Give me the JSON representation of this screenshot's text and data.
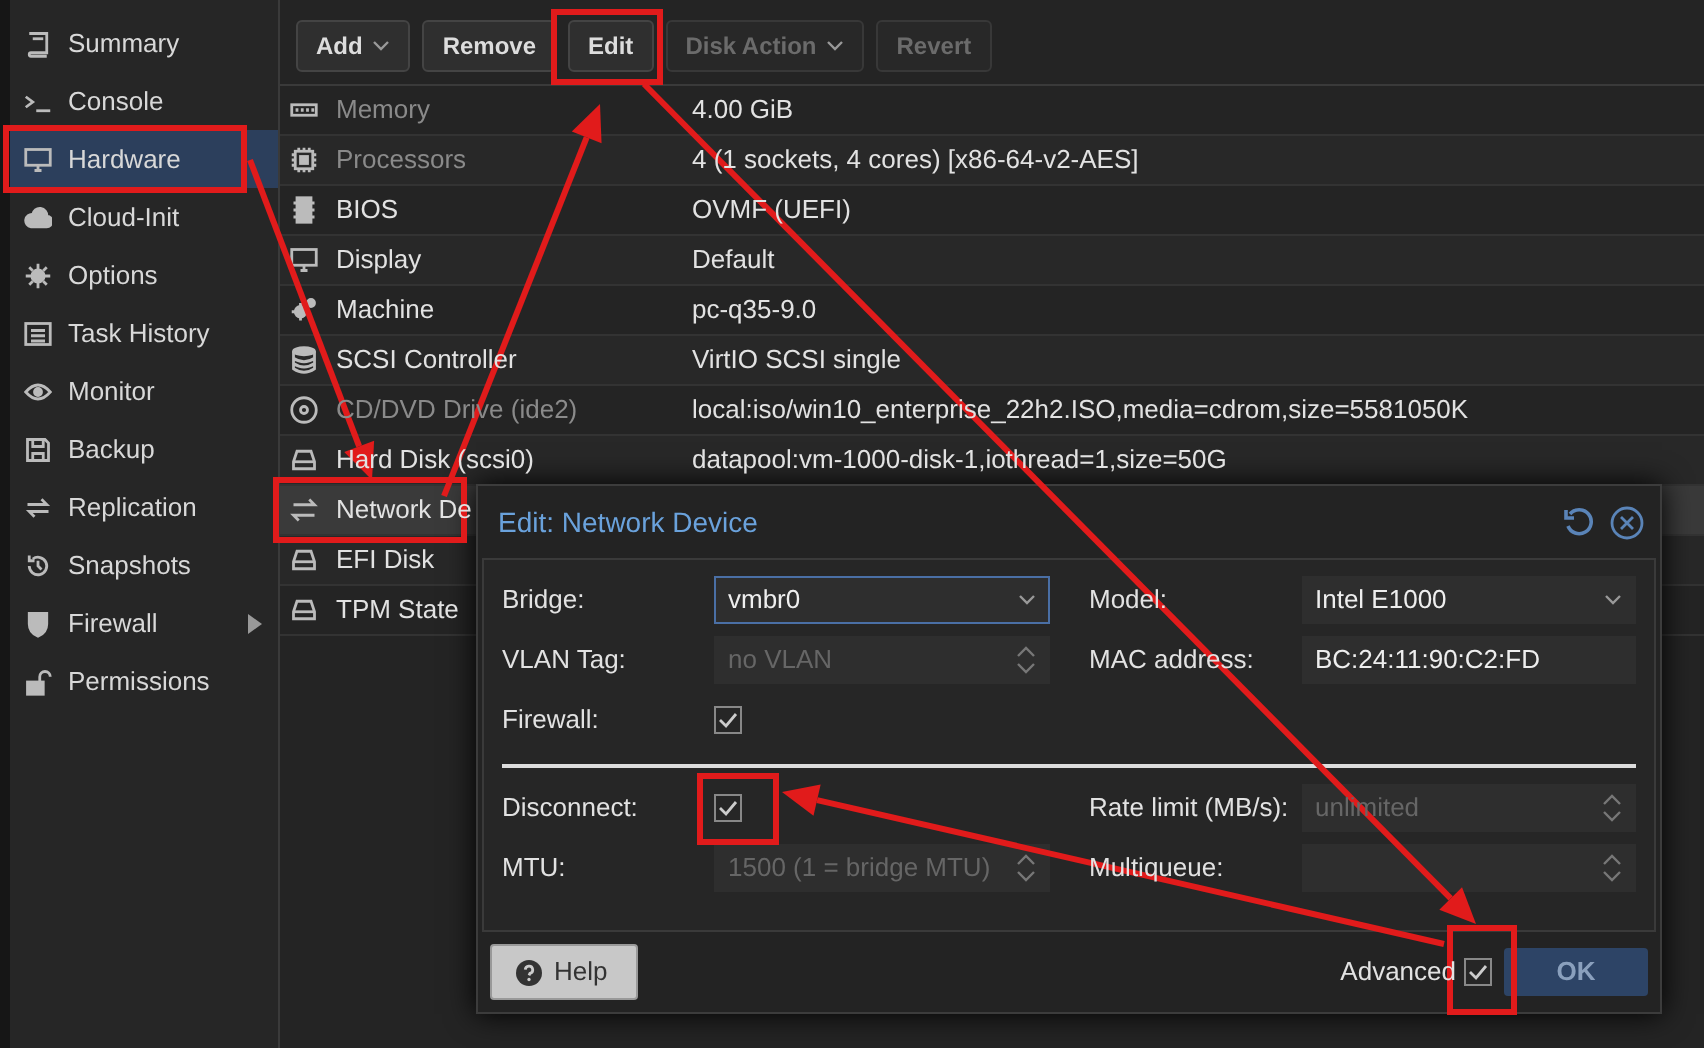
{
  "sidebar": {
    "items": [
      {
        "label": "Summary",
        "selected": false,
        "expandable": false
      },
      {
        "label": "Console",
        "selected": false,
        "expandable": false
      },
      {
        "label": "Hardware",
        "selected": true,
        "expandable": false
      },
      {
        "label": "Cloud-Init",
        "selected": false,
        "expandable": false
      },
      {
        "label": "Options",
        "selected": false,
        "expandable": false
      },
      {
        "label": "Task History",
        "selected": false,
        "expandable": false
      },
      {
        "label": "Monitor",
        "selected": false,
        "expandable": false
      },
      {
        "label": "Backup",
        "selected": false,
        "expandable": false
      },
      {
        "label": "Replication",
        "selected": false,
        "expandable": false
      },
      {
        "label": "Snapshots",
        "selected": false,
        "expandable": false
      },
      {
        "label": "Firewall",
        "selected": false,
        "expandable": true
      },
      {
        "label": "Permissions",
        "selected": false,
        "expandable": false
      }
    ]
  },
  "toolbar": {
    "buttons": [
      {
        "label": "Add",
        "dropdown": true,
        "disabled": false
      },
      {
        "label": "Remove",
        "dropdown": false,
        "disabled": false
      },
      {
        "label": "Edit",
        "dropdown": false,
        "disabled": false
      },
      {
        "label": "Disk Action",
        "dropdown": true,
        "disabled": true
      },
      {
        "label": "Revert",
        "dropdown": false,
        "disabled": true
      }
    ]
  },
  "hardware": {
    "rows": [
      {
        "name": "Memory",
        "value": "4.00 GiB",
        "dimmed": true,
        "selected": false
      },
      {
        "name": "Processors",
        "value": "4 (1 sockets, 4 cores) [x86-64-v2-AES]",
        "dimmed": true,
        "selected": false
      },
      {
        "name": "BIOS",
        "value": "OVMF (UEFI)",
        "dimmed": false,
        "selected": false
      },
      {
        "name": "Display",
        "value": "Default",
        "dimmed": false,
        "selected": false
      },
      {
        "name": "Machine",
        "value": "pc-q35-9.0",
        "dimmed": false,
        "selected": false
      },
      {
        "name": "SCSI Controller",
        "value": "VirtIO SCSI single",
        "dimmed": false,
        "selected": false
      },
      {
        "name": "CD/DVD Drive (ide2)",
        "value": "local:iso/win10_enterprise_22h2.ISO,media=cdrom,size=5581050K",
        "dimmed": true,
        "selected": false
      },
      {
        "name": "Hard Disk (scsi0)",
        "value": "datapool:vm-1000-disk-1,iothread=1,size=50G",
        "dimmed": false,
        "selected": false
      },
      {
        "name": "Network De",
        "dimmed": false,
        "selected": true
      },
      {
        "name": "EFI Disk",
        "dimmed": false,
        "selected": false
      },
      {
        "name": "TPM State",
        "dimmed": false,
        "selected": false
      }
    ]
  },
  "dialog": {
    "title": "Edit: Network Device",
    "general": {
      "left": [
        {
          "label": "Bridge:",
          "kind": "select",
          "value": "vmbr0",
          "focused": true
        },
        {
          "label": "VLAN Tag:",
          "kind": "spinner",
          "placeholder": "no VLAN",
          "focused": false
        },
        {
          "label": "Firewall:",
          "kind": "checkbox",
          "checked": true
        }
      ],
      "right": [
        {
          "label": "Model:",
          "kind": "select",
          "value": "Intel E1000",
          "focused": false
        },
        {
          "label": "MAC address:",
          "kind": "text",
          "value": "BC:24:11:90:C2:FD",
          "focused": false
        }
      ]
    },
    "advanced": {
      "left": [
        {
          "label": "Disconnect:",
          "kind": "checkbox",
          "checked": true
        },
        {
          "label": "MTU:",
          "kind": "spinner",
          "placeholder": "1500 (1 = bridge MTU)",
          "focused": false
        }
      ],
      "right": [
        {
          "label": "Rate limit (MB/s):",
          "kind": "spinner",
          "placeholder": "unlimited",
          "focused": false
        },
        {
          "label": "Multiqueue:",
          "kind": "spinner",
          "focused": false
        }
      ]
    },
    "help_button": "Help",
    "advanced_toggle": {
      "label": "Advanced",
      "checked": true
    },
    "ok_button": "OK"
  }
}
